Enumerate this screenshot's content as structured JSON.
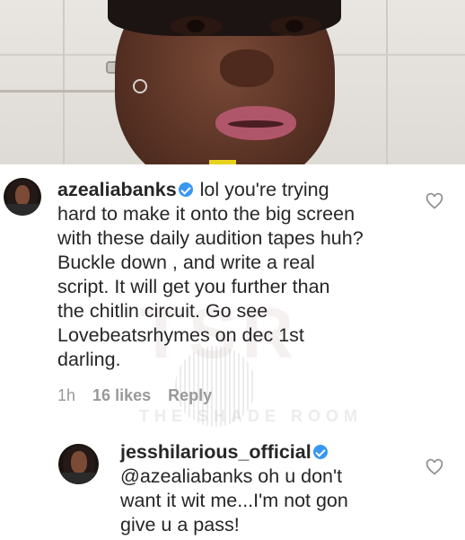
{
  "watermark": {
    "letters": "TSR",
    "label": "THE SHADE ROOM"
  },
  "comments": [
    {
      "username": "azealiabanks",
      "text_lines": [
        "lol you're trying",
        "hard to make it onto the big screen",
        "with these daily audition tapes huh?",
        "Buckle down , and write a real",
        "script. It will get you further than",
        "the chitlin circuit. Go see",
        "Lovebeatsrhymes on dec 1st",
        "darling."
      ],
      "time": "1h",
      "likes": "16 likes",
      "reply_label": "Reply",
      "icon": "heart-outline"
    },
    {
      "username": "jesshilarious_official",
      "text_lines": [
        "@azealiabanks oh u don't",
        "want it wit me...I'm not gon",
        "give u a pass!"
      ],
      "icon": "heart-outline"
    }
  ],
  "colors": {
    "text": "#262626",
    "meta": "#999999",
    "verified": "#3897f0"
  }
}
